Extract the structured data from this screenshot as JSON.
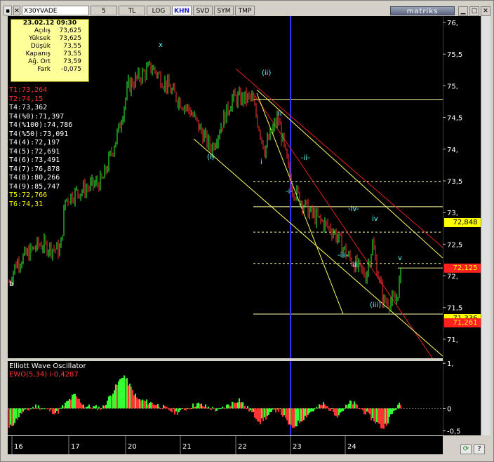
{
  "toolbar": {
    "buttons": [
      "X30YVADE",
      "5",
      "TL",
      "LOG",
      "KHN",
      "SVD",
      "SYM",
      "TMP"
    ],
    "selected": "KHN",
    "brand": "matriks",
    "win_min": "▁",
    "win_max": "□",
    "win_close": "✕"
  },
  "info": {
    "datetime": "23.02.12 09:30",
    "rows": [
      {
        "k": "Açılış",
        "v": "73,625"
      },
      {
        "k": "Yüksek",
        "v": "73,625"
      },
      {
        "k": "Düşük",
        "v": "73,55"
      },
      {
        "k": "Kapanış",
        "v": "73,55"
      },
      {
        "k": "Ağ. Ort",
        "v": "73,59"
      },
      {
        "k": "Fark",
        "v": "-0,075"
      }
    ]
  },
  "levels": [
    {
      "text": "T1:73,264",
      "color": "#ff3333"
    },
    {
      "text": "T2:74,15",
      "color": "#ff3333"
    },
    {
      "text": "T4:73,362",
      "color": "#ffffff"
    },
    {
      "text": "T4(%0):71,397",
      "color": "#ffffff"
    },
    {
      "text": "T4(%100):74,786",
      "color": "#ffffff"
    },
    {
      "text": "T4(%50):73,091",
      "color": "#ffffff"
    },
    {
      "text": "T4(4):72,197",
      "color": "#ffffff"
    },
    {
      "text": "T4(5):72,691",
      "color": "#ffffff"
    },
    {
      "text": "T4(6):73,491",
      "color": "#ffffff"
    },
    {
      "text": "T4(7):76,878",
      "color": "#ffffff"
    },
    {
      "text": "T4(8):80,266",
      "color": "#ffffff"
    },
    {
      "text": "T4(9):85,747",
      "color": "#ffffff"
    },
    {
      "text": "T5:72,766",
      "color": "#ffff00"
    },
    {
      "text": "T6:74,31",
      "color": "#ffff00"
    }
  ],
  "price_axis": {
    "ticks": [
      "76,",
      "75,5",
      "75,",
      "74,5",
      "74,",
      "73,5",
      "73,",
      "72,5",
      "72,",
      "71,5",
      "71,"
    ],
    "values": [
      76,
      75.5,
      75,
      74.5,
      74,
      73.5,
      73,
      72.5,
      72,
      71.5,
      71
    ],
    "labels": [
      {
        "text": "72,848",
        "value": 72.848,
        "bg": "#ffff00",
        "fg": "#000000"
      },
      {
        "text": "72,125",
        "value": 72.125,
        "bg": "#ff2020",
        "fg": "#ffff00"
      },
      {
        "text": "71,336",
        "value": 71.336,
        "bg": "#ffff00",
        "fg": "#000000"
      },
      {
        "text": "71,261",
        "value": 71.261,
        "bg": "#ff2020",
        "fg": "#ffff00"
      }
    ]
  },
  "wave_labels": [
    "x",
    "b",
    "(ii)",
    "(i)",
    "i",
    "ii",
    "-ii-",
    "-i-",
    "-iv-",
    "iv",
    "-iii-",
    "iii",
    "(iii)",
    "v"
  ],
  "oscillator": {
    "title": "Elliott Wave Oscillator",
    "legend": "EWO(5,34)  i-0,4287",
    "ticks": [
      "1,",
      "0",
      "-0,5"
    ],
    "values": [
      1,
      0,
      -0.5
    ]
  },
  "x_axis": {
    "days": [
      "16",
      "17",
      "20",
      "21",
      "22",
      "23",
      "24"
    ]
  },
  "controls": {
    "refresh": "⟳",
    "help": "?"
  },
  "colors": {
    "up": "#33ff33",
    "down": "#ff3333",
    "channel_red": "#e02020",
    "channel_yellow": "#ffff66",
    "separator": "#3030ff",
    "wave_label": "#66ffff"
  }
}
